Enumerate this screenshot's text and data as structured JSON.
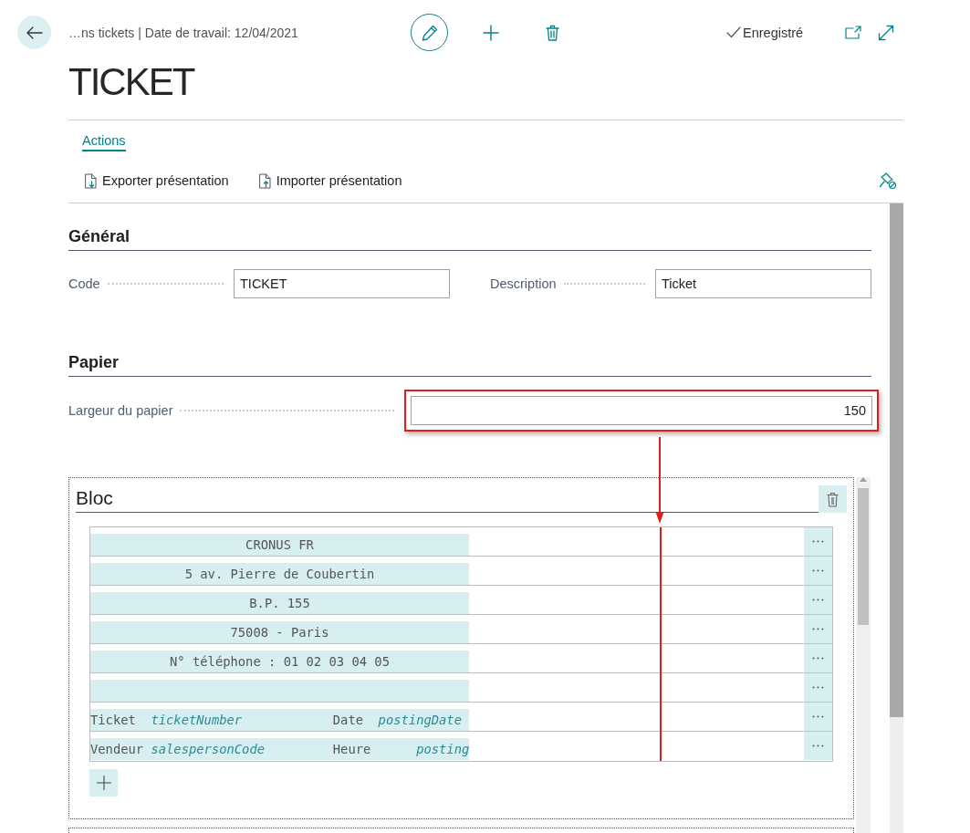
{
  "header": {
    "breadcrumb": "…ns tickets | Date de travail: 12/04/2021",
    "status": "Enregistré"
  },
  "title": "TICKET",
  "action_tabs": [
    {
      "label": "Actions",
      "selected": true
    }
  ],
  "actions": [
    {
      "kind": "export",
      "label": "Exporter présentation"
    },
    {
      "kind": "import",
      "label": "Importer présentation"
    }
  ],
  "sections": [
    {
      "title": "Général",
      "fields": [
        {
          "label": "Code",
          "value": "TICKET",
          "right_aligned": false,
          "highlighted": false
        },
        {
          "label": "Description",
          "value": "Ticket",
          "right_aligned": false,
          "highlighted": false
        }
      ]
    },
    {
      "title": "Papier",
      "fields": [
        {
          "label": "Largeur du papier",
          "value": "150",
          "right_aligned": true,
          "highlighted": true
        }
      ]
    }
  ],
  "block": {
    "title": "Bloc",
    "rows": [
      {
        "kind": "text",
        "text": "CRONUS FR",
        "centered": true
      },
      {
        "kind": "text",
        "text": "5 av. Pierre de Coubertin",
        "centered": true
      },
      {
        "kind": "text",
        "text": "B.P. 155",
        "centered": true
      },
      {
        "kind": "text",
        "text": "75008 - Paris",
        "centered": true
      },
      {
        "kind": "text",
        "text": "N° téléphone : 01 02 03 04 05",
        "centered": true
      },
      {
        "kind": "blank"
      },
      {
        "kind": "columns",
        "parts": [
          {
            "kind": "label",
            "text": "Ticket",
            "right_aligned": false
          },
          {
            "kind": "field",
            "text": "ticketNumber",
            "right_aligned": false
          },
          {
            "kind": "label",
            "text": "Date",
            "right_aligned": false
          },
          {
            "kind": "field",
            "text": "postingDate",
            "right_aligned": false
          }
        ]
      },
      {
        "kind": "columns",
        "parts": [
          {
            "kind": "label",
            "text": "Vendeur",
            "right_aligned": false
          },
          {
            "kind": "field",
            "text": "salespersonCode",
            "right_aligned": false
          },
          {
            "kind": "label",
            "text": "Heure",
            "right_aligned": false
          },
          {
            "kind": "field",
            "text": "posting",
            "right_aligned": true
          }
        ]
      }
    ]
  }
}
